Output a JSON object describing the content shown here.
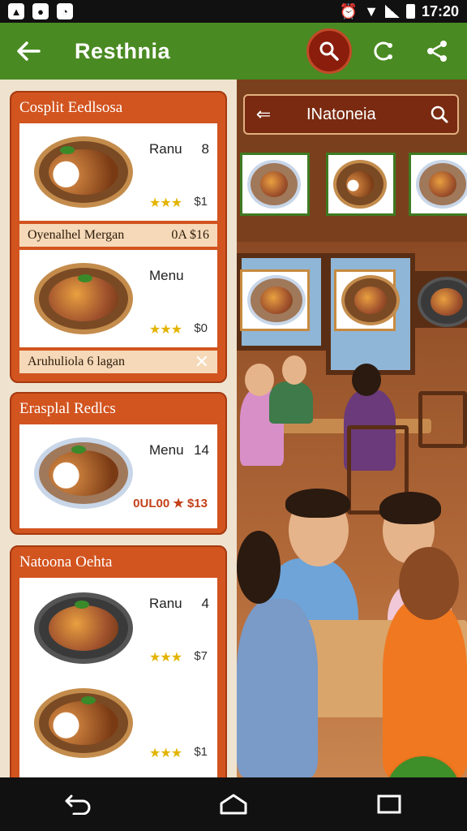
{
  "status": {
    "time": "17:20",
    "left_icons": [
      "photo-icon",
      "notification-icon",
      "clock-icon"
    ]
  },
  "app_bar": {
    "title": "Resthnia"
  },
  "cards": [
    {
      "title": "Cosplit Eedlsosa",
      "items": [
        {
          "name": "Ranu",
          "number": "8",
          "price": "$1",
          "rating": 3
        },
        {
          "name": "Menu",
          "number": "",
          "price": "$0",
          "rating": 3
        }
      ],
      "bars": [
        {
          "left": "Oyenalhel Mergan",
          "right": "0A $16"
        },
        {
          "left": "Aruhuliola 6 lagan",
          "right": ""
        }
      ]
    },
    {
      "title": "Erasplal Redlcs",
      "items": [
        {
          "name": "Menu",
          "number": "14",
          "price": "0UL00 ★ $13",
          "rating": 0
        }
      ]
    },
    {
      "title": "Natoona Oehta",
      "items": [
        {
          "name": "Ranu",
          "number": "4",
          "price": "$7",
          "rating": 3
        },
        {
          "name": "",
          "number": "",
          "price": "$1",
          "rating": 3
        }
      ]
    }
  ],
  "right_panel": {
    "search_text": "INatoneia"
  },
  "colors": {
    "primary": "#4a8a22",
    "accent": "#d2541f",
    "search_bg": "#8a1d0b"
  }
}
